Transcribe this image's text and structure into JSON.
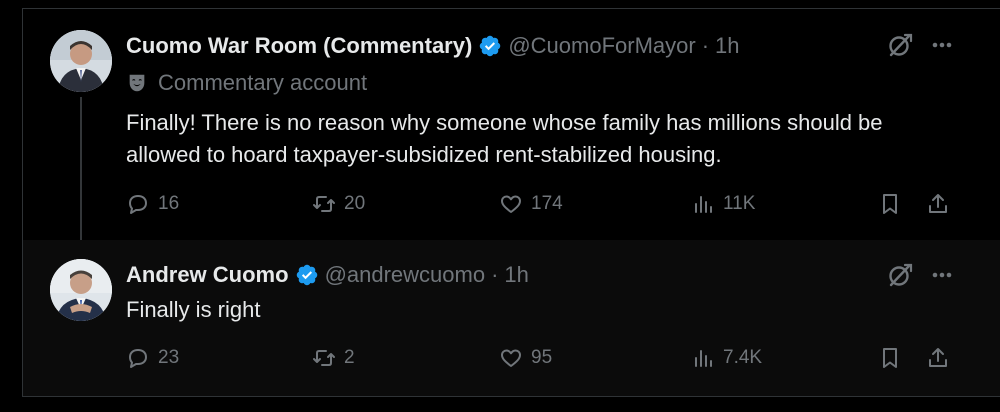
{
  "tweets": [
    {
      "display_name": "Cuomo War Room (Commentary)",
      "handle": "@CuomoForMayor",
      "separator": "·",
      "time": "1h",
      "label": "Commentary account",
      "body": "Finally! There is no reason why someone whose family has millions should be allowed to hoard taxpayer-subsidized rent-stabilized housing.",
      "replies": "16",
      "reposts": "20",
      "likes": "174",
      "views": "11K"
    },
    {
      "display_name": "Andrew Cuomo",
      "handle": "@andrewcuomo",
      "separator": "·",
      "time": "1h",
      "body": "Finally is right",
      "replies": "23",
      "reposts": "2",
      "likes": "95",
      "views": "7.4K"
    }
  ],
  "icons": {
    "verified": "verified-badge-icon",
    "commentary": "theater-mask-icon",
    "grok": "grok-icon",
    "more": "more-icon",
    "reply": "reply-icon",
    "repost": "repost-icon",
    "like": "heart-icon",
    "views": "views-icon",
    "bookmark": "bookmark-icon",
    "share": "share-icon"
  },
  "colors": {
    "background": "#000000",
    "text": "#e7e9ea",
    "secondary": "#71767b",
    "verified": "#1d9bf0",
    "border": "#2f3336"
  }
}
